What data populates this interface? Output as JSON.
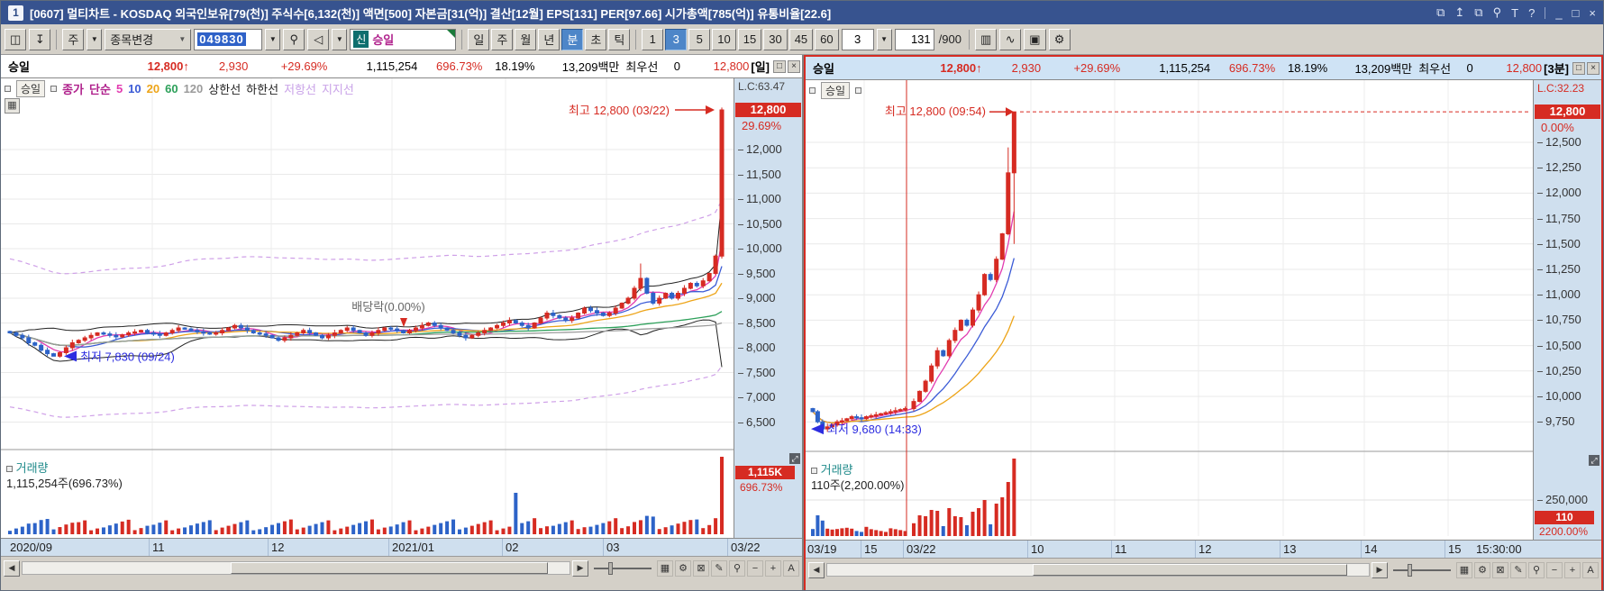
{
  "window": {
    "badge": "1",
    "title": "[0607] 멀티차트 - KOSDAQ 외국인보유[79(천)]  주식수[6,132(천)]  액면[500]  자본금[31(억)]  결산[12월]  EPS[131]  PER[97.66]  시가총액[785(억)]  유통비율[22.6]"
  },
  "toolbar": {
    "week_button": "주",
    "stock_change_button": "종목변경",
    "code_value": "049830",
    "market_badge": "신",
    "stock_name": "승일",
    "period_buttons": [
      "일",
      "주",
      "월",
      "년",
      "분",
      "초",
      "틱"
    ],
    "active_period": "분",
    "minute_buttons": [
      "1",
      "3",
      "5",
      "10",
      "15",
      "30",
      "45",
      "60"
    ],
    "active_minute": "3",
    "minute_select": "3",
    "bar_count": "131",
    "bar_total": "/900"
  },
  "header": {
    "name": "승일",
    "price": "12,800",
    "arrow": "↑",
    "change": "2,930",
    "change_pct": "+29.69%",
    "volume": "1,115,254",
    "volume_pct": "696.73%",
    "turnover": "18.19%",
    "amount": "13,209백만",
    "best_label": "최우선",
    "best_bid": "0",
    "best_ask": "12,800"
  },
  "indicators": {
    "name": "승일",
    "price_label": "종가",
    "ma_label": "단순",
    "ma_periods": [
      "5",
      "10",
      "20",
      "60",
      "120"
    ],
    "upper_label": "상한선",
    "lower_label": "하한선",
    "resistance_label": "저항선",
    "support_label": "지지선"
  },
  "left_pane": {
    "frame_label": "[일]",
    "axis": {
      "lc": "L.C:63.47",
      "price_badge": "12,800",
      "pct": "29.69%"
    },
    "annotations": {
      "high": "최고 12,800 (03/22)",
      "dividend": "배당락(0.00%)",
      "low": "최저 7,830 (09/24)"
    },
    "volume": {
      "title": "거래량",
      "detail": "1,115,254주(696.73%)",
      "badge": "1,115K",
      "badge_pct": "696.73%"
    }
  },
  "right_pane": {
    "frame_label": "[3분]",
    "indicator_name": "승일",
    "axis": {
      "lc": "L.C:32.23",
      "price_badge": "12,800",
      "pct": "0.00%"
    },
    "annotations": {
      "high": "최고 12,800 (09:54)",
      "low": "최저 9,680 (14:33)"
    },
    "volume": {
      "title": "거래량",
      "detail": "110주(2,200.00%)",
      "tick": "250,000",
      "badge": "110",
      "badge_pct": "2200.00%"
    },
    "end_time": "15:30:00"
  },
  "chart_data": [
    {
      "type": "candlestick",
      "title": "승일 일봉 (daily)",
      "frame": "일",
      "y_ticks": [
        12000,
        11500,
        11000,
        10500,
        10000,
        9500,
        9000,
        8500,
        8000,
        7500,
        7000,
        6500
      ],
      "x_labels": [
        {
          "t": "2020/09",
          "x": 10
        },
        {
          "t": "11",
          "x": 168
        },
        {
          "t": "12",
          "x": 300
        },
        {
          "t": "2021/01",
          "x": 434
        },
        {
          "t": "02",
          "x": 560
        },
        {
          "t": "03",
          "x": 672
        },
        {
          "t": "03/22",
          "x": 810
        }
      ],
      "closes": [
        8300,
        8250,
        8200,
        8100,
        8050,
        7950,
        7880,
        7830,
        7900,
        8000,
        8100,
        8150,
        8200,
        8250,
        8300,
        8280,
        8250,
        8220,
        8260,
        8300,
        8320,
        8350,
        8300,
        8280,
        8250,
        8300,
        8350,
        8400,
        8380,
        8350,
        8320,
        8300,
        8280,
        8300,
        8350,
        8400,
        8450,
        8400,
        8350,
        8300,
        8280,
        8250,
        8200,
        8150,
        8200,
        8250,
        8300,
        8350,
        8300,
        8250,
        8200,
        8250,
        8300,
        8350,
        8400,
        8350,
        8300,
        8250,
        8300,
        8350,
        8400,
        8380,
        8350,
        8300,
        8350,
        8400,
        8450,
        8500,
        8450,
        8400,
        8350,
        8300,
        8250,
        8200,
        8250,
        8300,
        8350,
        8400,
        8450,
        8500,
        8550,
        8500,
        8450,
        8400,
        8500,
        8600,
        8700,
        8650,
        8600,
        8550,
        8600,
        8700,
        8800,
        8750,
        8700,
        8650,
        8700,
        8800,
        8900,
        9000,
        9200,
        9400,
        9100,
        8900,
        9000,
        9100,
        9000,
        9100,
        9200,
        9300,
        9250,
        9350,
        9500,
        9850,
        12800
      ],
      "high_point": {
        "price": 12800,
        "when": "03/22"
      },
      "low_point": {
        "price": 7830,
        "when": "09/24"
      },
      "last_price": 12800,
      "volume_total": "1,115,254"
    },
    {
      "type": "candlestick",
      "title": "승일 3분봉 (3-minute)",
      "frame": "3분",
      "y_ticks": [
        12500,
        12250,
        12000,
        11750,
        11500,
        11250,
        11000,
        10750,
        10500,
        10250,
        10000,
        9750
      ],
      "x_labels": [
        {
          "t": "03/19",
          "x": 2
        },
        {
          "t": "15",
          "x": 65
        },
        {
          "t": "03/22",
          "x": 112
        },
        {
          "t": "10",
          "x": 250
        },
        {
          "t": "11",
          "x": 343
        },
        {
          "t": "12",
          "x": 436
        },
        {
          "t": "13",
          "x": 530
        },
        {
          "t": "14",
          "x": 620
        },
        {
          "t": "15",
          "x": 713
        }
      ],
      "closes": [
        9850,
        9750,
        9680,
        9700,
        9720,
        9750,
        9760,
        9780,
        9800,
        9790,
        9780,
        9800,
        9810,
        9820,
        9830,
        9840,
        9850,
        9860,
        9870,
        9880,
        9950,
        10050,
        10150,
        10300,
        10450,
        10400,
        10550,
        10650,
        10750,
        10700,
        10850,
        11000,
        11200,
        11150,
        11350,
        11600,
        12200,
        12800
      ],
      "day_split_index": 20,
      "high_point": {
        "price": 12800,
        "when": "09:54"
      },
      "low_point": {
        "price": 9680,
        "when": "14:33"
      },
      "last_price": 12800,
      "limit_price": 12800,
      "volume_total": "110"
    }
  ],
  "colors": {
    "titlebar_bg": "#37538f",
    "up": "#d62b22",
    "down": "#2d63c8",
    "accent_blue": "#4e86c8",
    "axis_bg": "#cfdfee",
    "teal": "#1f8a8a",
    "magenta": "#b0218c",
    "ma5": "#e23bb0",
    "ma10": "#3b5bd6",
    "ma20": "#eda418",
    "ma60": "#2da05a",
    "ma120": "#9b9b9b",
    "envelope_violet": "#cfa0e8",
    "band_black": "#222222",
    "red_line": "#d62b22",
    "grid": "#e9e9e9"
  },
  "icons": {
    "dropdown": "▼",
    "left_arrow": "◀",
    "right_arrow": "▶",
    "minimize": "_",
    "maximize": "□",
    "close": "×",
    "pane_restore": "□",
    "pane_close": "×",
    "popout": "⧉",
    "align_top": "↥",
    "duplicate": "⧉",
    "pin": "⚲",
    "font": "T",
    "help": "?",
    "panel": "◫",
    "save_down": "↧",
    "search": "⚲",
    "speaker": "◁",
    "grid": "▦",
    "gear": "⚙",
    "cross": "⊠",
    "pencil": "✎",
    "magnify": "⚲",
    "minus": "−",
    "plus": "+",
    "auto": "A",
    "indicator_add": "▥",
    "trend_add": "∿",
    "save": "▣",
    "settings": "⚙",
    "checkbox": "▫",
    "table": "▦",
    "expand": "⤢"
  }
}
